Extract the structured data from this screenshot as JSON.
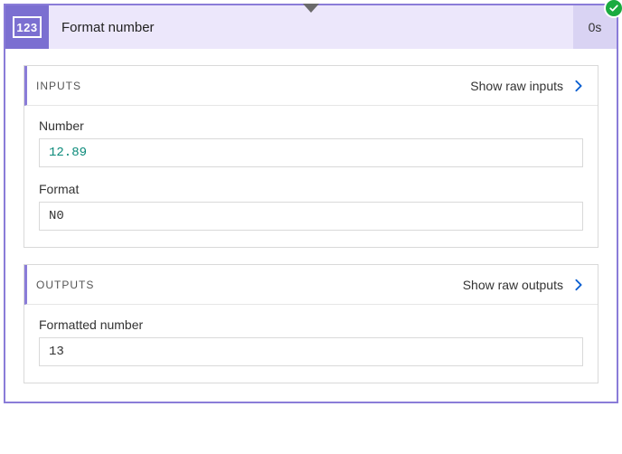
{
  "header": {
    "icon_text": "123",
    "title": "Format number",
    "duration": "0s"
  },
  "inputs": {
    "section_label": "INPUTS",
    "show_raw_label": "Show raw inputs",
    "fields": {
      "number": {
        "label": "Number",
        "value": "12.89"
      },
      "format": {
        "label": "Format",
        "value": "N0"
      }
    }
  },
  "outputs": {
    "section_label": "OUTPUTS",
    "show_raw_label": "Show raw outputs",
    "fields": {
      "formatted_number": {
        "label": "Formatted number",
        "value": "13"
      }
    }
  }
}
